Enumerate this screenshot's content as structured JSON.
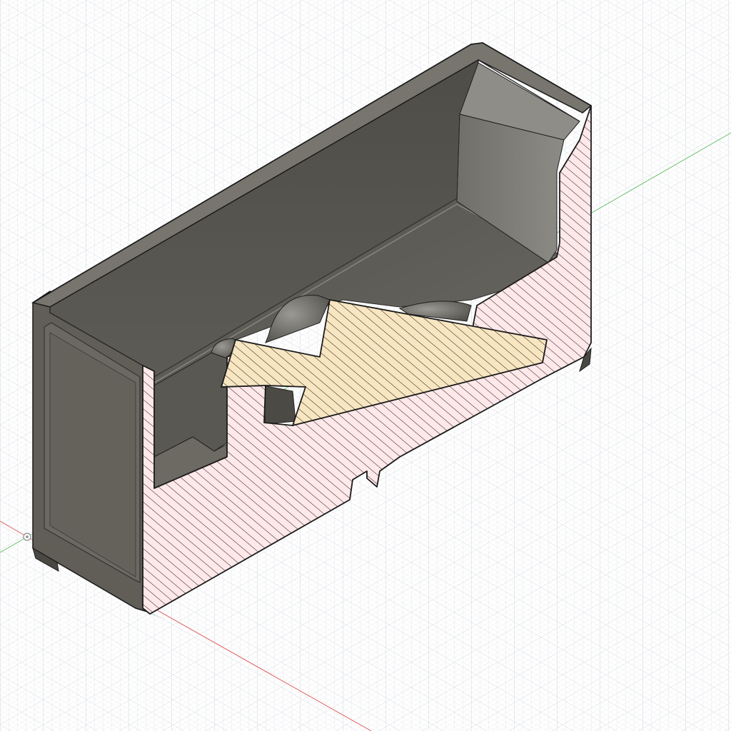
{
  "viewport": {
    "label": "",
    "colors": {
      "background": "#ffffff",
      "grid_minor": "#eceef1",
      "grid_major": "#d6d9de",
      "axis_x": "#e06060",
      "axis_y": "#6cc06c",
      "body_dark": "#54524c",
      "body_mid": "#66645d",
      "body_light": "#7d7b74",
      "section_body": "#fde8ea",
      "section_body_hatch": "#2a1a1a",
      "section_insert": "#f8e6c2",
      "section_insert_hatch": "#2a2210",
      "edge": "#1a1a1a"
    },
    "icons": [
      "origin-icon"
    ]
  }
}
